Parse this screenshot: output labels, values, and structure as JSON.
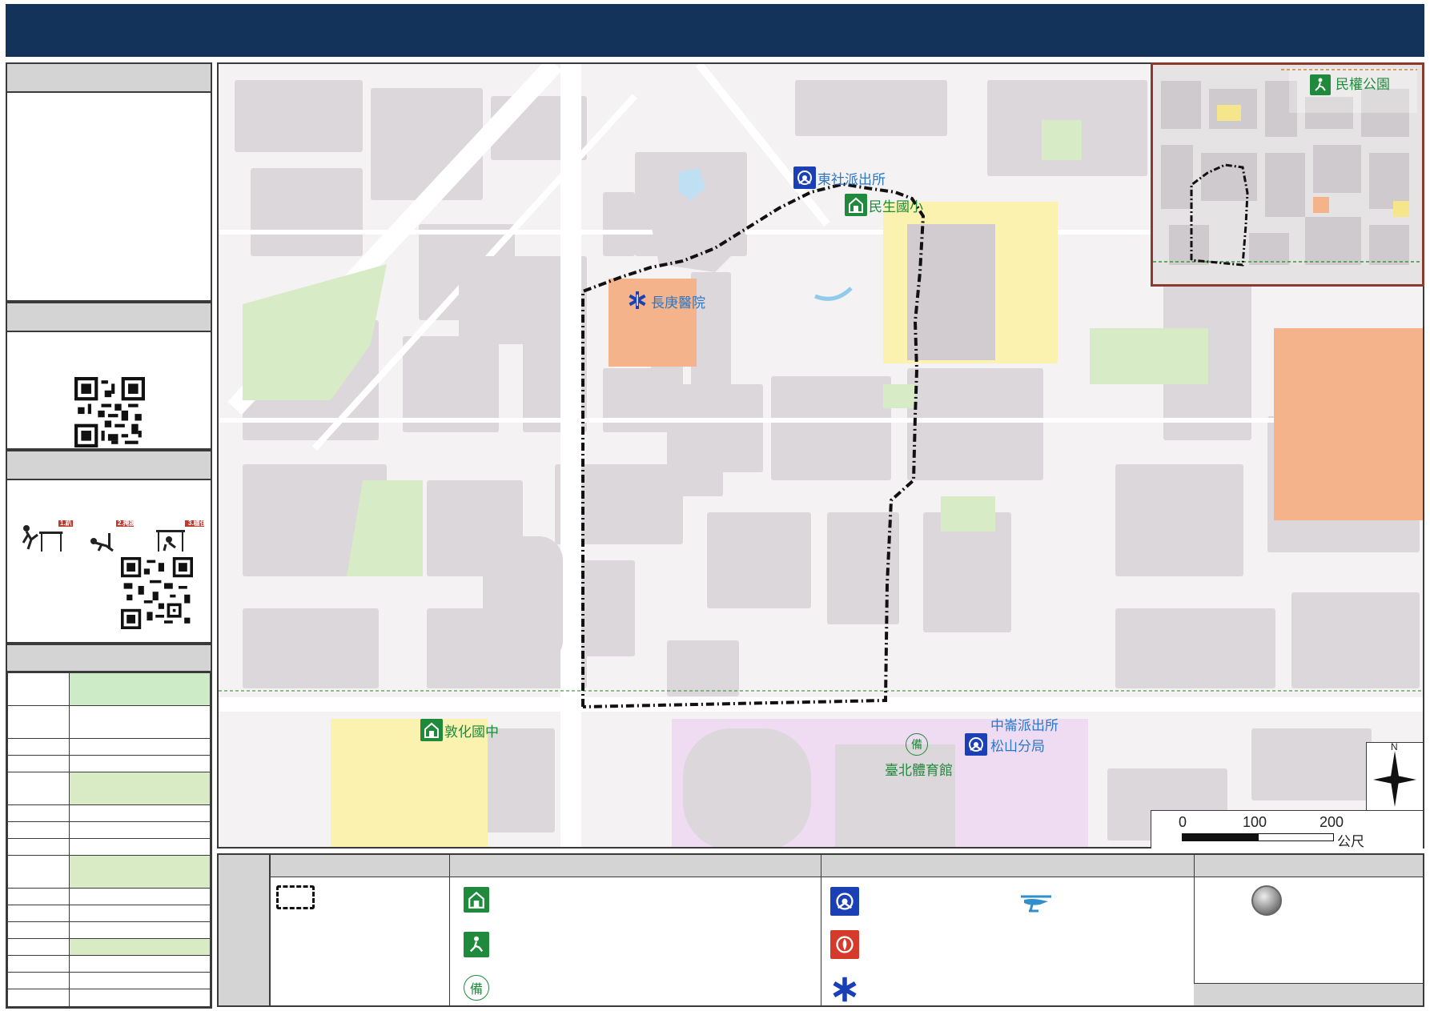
{
  "header": {
    "title": ""
  },
  "sidebar": {
    "panels": [
      {
        "id": "overview",
        "heading": ""
      },
      {
        "id": "qr",
        "heading": ""
      },
      {
        "id": "earthquake",
        "heading": "",
        "steps": [
          "1.趴下",
          "2.掩護",
          "3.穩住"
        ]
      },
      {
        "id": "info",
        "heading": ""
      }
    ]
  },
  "map": {
    "facilities": {
      "police_dongshe": "東社派出所",
      "school_minsheng": "民生國小",
      "hospital_changgung": "長庚醫院",
      "school_dunhua": "敦化國中",
      "police_zhonglun": "中崙派出所",
      "police_songshan": "松山分局",
      "reserve_label": "備",
      "gym": "臺北體育館"
    },
    "inset": {
      "park": "民權公園"
    },
    "scale": {
      "ticks": [
        "0",
        "100",
        "200"
      ],
      "unit": "公尺"
    },
    "north_label": "N",
    "colors": {
      "header": "#13335a",
      "school_zone": "#fbf2b0",
      "park_green": "#d6ebc6",
      "hospital_orange": "#f4b38b",
      "sports_purple": "#efdcf3",
      "police_blue": "#1b3fb5",
      "fire_red": "#d63a2a",
      "shelter_green": "#1f8a3b",
      "road_blue_text": "#2a78c8"
    }
  },
  "legend": {
    "reserve_symbol": "備"
  }
}
